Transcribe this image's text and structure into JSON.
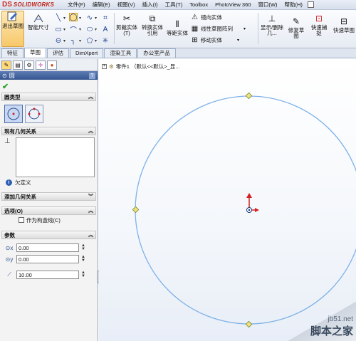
{
  "app": {
    "logo_mark": "DS",
    "logo_text": "SOLIDWORKS"
  },
  "menu": [
    "文件(F)",
    "编辑(E)",
    "视图(V)",
    "插入(I)",
    "工具(T)",
    "Toolbox",
    "PhotoView 360",
    "窗口(W)",
    "帮助(H)"
  ],
  "toolbar": {
    "exit_sketch": "退出草图",
    "smart_dim": "智能尺寸",
    "trim": "剪裁实体(T)",
    "convert": "转换实体引用",
    "offset": "等距实体",
    "mirror": "镜向实体",
    "linear_pattern": "线性草图阵列",
    "move": "移动实体",
    "display_delete": "显示/删除几...",
    "repair": "修复草图",
    "quick_snap": "快速捕捉",
    "quick_view": "快速草图"
  },
  "tabs": [
    "特征",
    "草图",
    "评估",
    "DimXpert",
    "渲染工具",
    "办公室产品"
  ],
  "active_tab": 1,
  "panel": {
    "title": "圆",
    "help": "?",
    "circle_type_header": "圆类型",
    "existing_relations_header": "现有几何关系",
    "status": "欠定义",
    "add_relations_header": "添加几何关系",
    "options_header": "选项(O)",
    "construction_label": "作为构造线(C)",
    "params_header": "参数",
    "param_cx": "0.00",
    "param_cy": "0.00",
    "param_r": "10.00"
  },
  "tree": {
    "part": "零件1 （默认<<默认>_显..."
  },
  "watermark": {
    "site": "jb51.net",
    "text": "脚本之家"
  },
  "colors": {
    "circle": "#7fb2e8",
    "origin": "#d42020",
    "accent": "#34558f"
  }
}
